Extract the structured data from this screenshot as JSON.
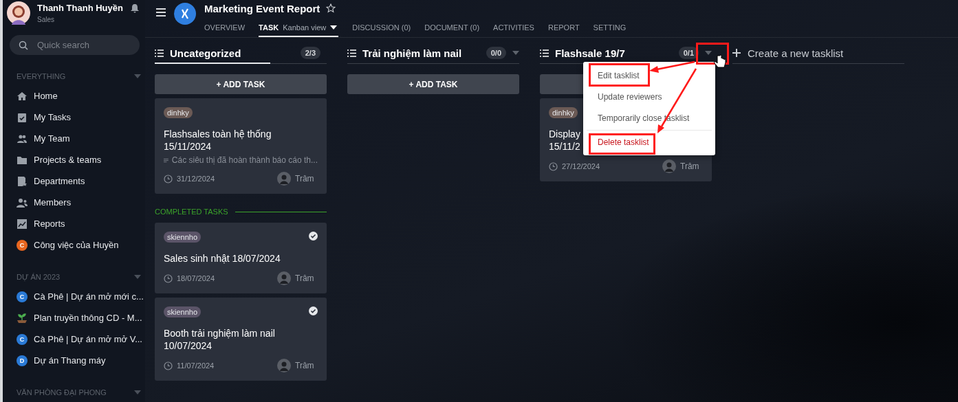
{
  "user": {
    "name": "Thanh Thanh Huyền",
    "role": "Sales"
  },
  "search": {
    "placeholder": "Quick search"
  },
  "sidebar": {
    "sections": [
      {
        "title": "EVERYTHING",
        "items": [
          {
            "kind": "nav",
            "label": "Home"
          },
          {
            "kind": "nav",
            "label": "My Tasks"
          },
          {
            "kind": "nav",
            "label": "My Team"
          },
          {
            "kind": "nav",
            "label": "Projects & teams"
          },
          {
            "kind": "nav",
            "label": "Departments"
          },
          {
            "kind": "nav",
            "label": "Members"
          },
          {
            "kind": "nav",
            "label": "Reports"
          },
          {
            "kind": "project",
            "letter": "C",
            "color": "#e8661f",
            "label": "Công việc của Huyền"
          }
        ]
      },
      {
        "title": "DỰ ÁN 2023",
        "items": [
          {
            "kind": "project",
            "letter": "C",
            "color": "#2a7ad6",
            "label": "Cà Phê | Dự án mở mới c..."
          },
          {
            "kind": "plant",
            "label": "Plan truyền thông CD - M..."
          },
          {
            "kind": "project",
            "letter": "C",
            "color": "#2a7ad6",
            "label": "Cà Phê | Dự án mở mở V..."
          },
          {
            "kind": "project",
            "letter": "D",
            "color": "#2a7ad6",
            "label": "Dự án Thang máy"
          }
        ]
      },
      {
        "title": "VĂN PHÒNG ĐẠI PHONG"
      }
    ]
  },
  "header": {
    "title": "Marketing Event Report",
    "tabs": [
      {
        "label": "OVERVIEW",
        "selected": false
      },
      {
        "label": "TASK",
        "sublabel": "Kanban view",
        "selected": true
      },
      {
        "label": "DISCUSSION (0)",
        "selected": false
      },
      {
        "label": "DOCUMENT (0)",
        "selected": false
      },
      {
        "label": "ACTIVITIES",
        "selected": false
      },
      {
        "label": "REPORT",
        "selected": false
      },
      {
        "label": "SETTING",
        "selected": false
      }
    ]
  },
  "columns": [
    {
      "title": "Uncategorized",
      "count": "2/3",
      "level": 0.67,
      "has_menu": false,
      "add_button": "+ ADD TASK",
      "tasks": [
        {
          "tag": "dinhky",
          "color": "#6b5a55",
          "title": "Flashsales toàn hệ thống\n15/11/2024",
          "description": "Các siêu thị đã hoàn thành báo cáo th...",
          "due": "31/12/2024",
          "assignee": "Trâm"
        }
      ],
      "completed_label": "COMPLETED TASKS",
      "completed": [
        {
          "tag": "skiennho",
          "color": "#5b5468",
          "title": "Sales sinh nhật 18/07/2024",
          "due": "18/07/2024",
          "assignee": "Trâm"
        },
        {
          "tag": "skiennho",
          "color": "#5b5468",
          "title": "Booth trải nghiệm làm nail\n10/07/2024",
          "due": "11/07/2024",
          "assignee": "Trâm"
        }
      ]
    },
    {
      "title": "Trải nghiệm làm nail",
      "count": "0/0",
      "level": 0,
      "has_menu": true,
      "add_button": "+ ADD TASK"
    },
    {
      "title": "Flashsale 19/7",
      "count": "0/1",
      "level": 0,
      "has_menu": true,
      "tasks": [
        {
          "tag": "dinhky",
          "color": "#6b5a55",
          "title": "Display\n15/11/2",
          "due": "27/12/2024",
          "assignee": "Trâm"
        }
      ],
      "menu": [
        {
          "label": "Edit tasklist",
          "kind": "normal"
        },
        {
          "label": "Update reviewers",
          "kind": "normal"
        },
        {
          "label": "Temporarily close tasklist",
          "kind": "normal"
        },
        {
          "label": "Delete tasklist",
          "kind": "danger"
        }
      ]
    }
  ],
  "new_tasklist": "Create a new tasklist"
}
